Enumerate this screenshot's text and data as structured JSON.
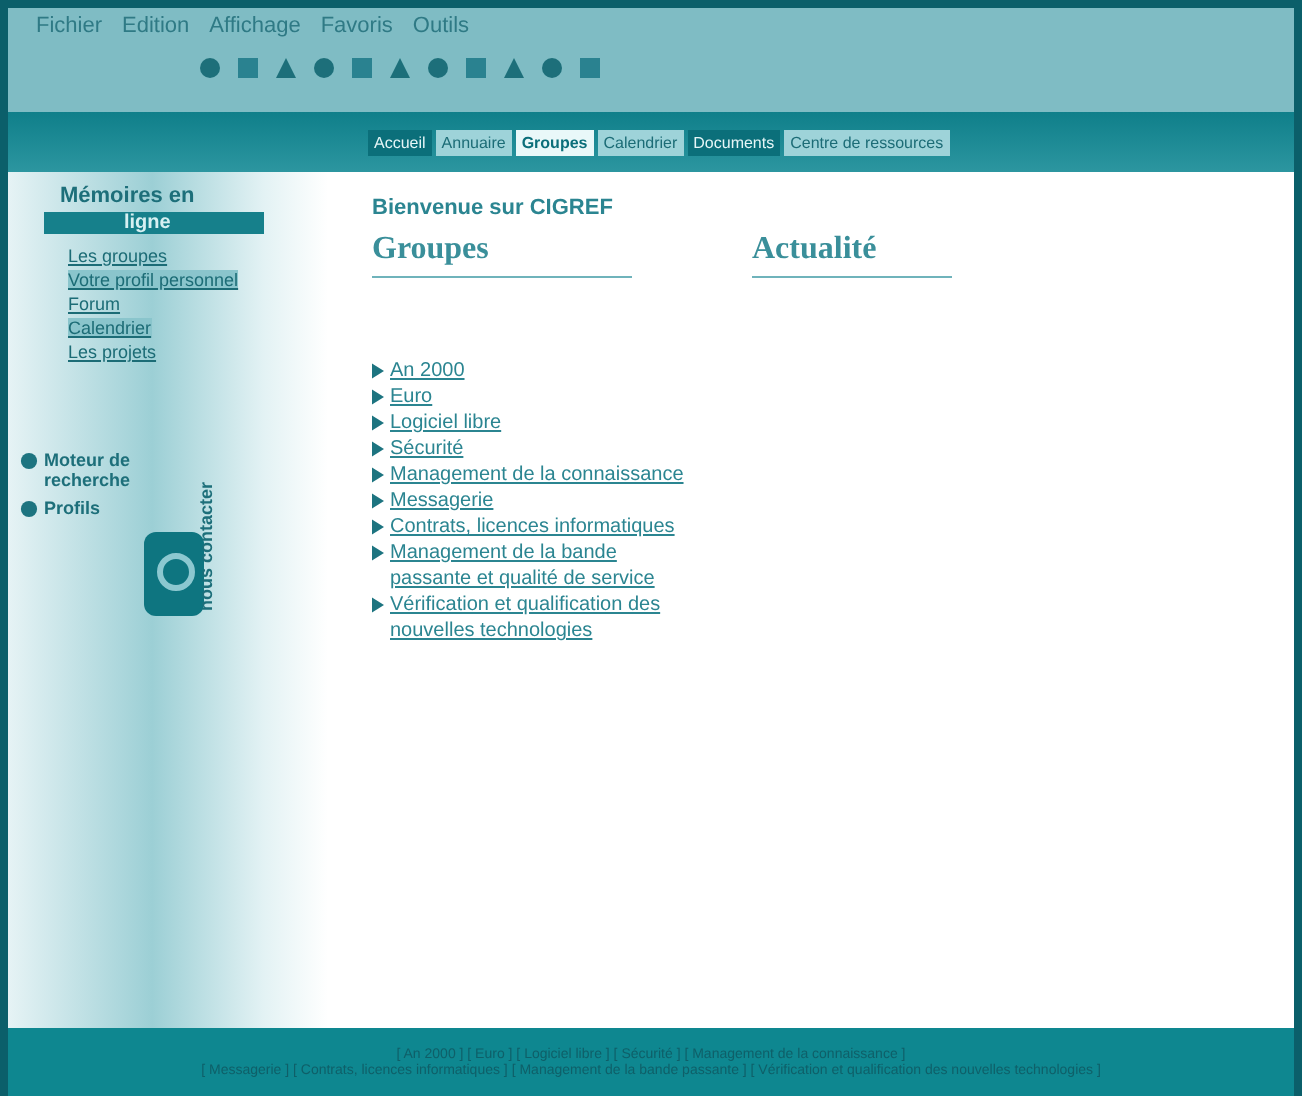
{
  "menu": [
    "Fichier",
    "Edition",
    "Affichage",
    "Favoris",
    "Outils"
  ],
  "toolbar_buttons": [
    {
      "kind": "round"
    },
    {
      "kind": "square"
    },
    {
      "kind": "triangle"
    },
    {
      "kind": "round"
    },
    {
      "kind": "square"
    },
    {
      "kind": "triangle"
    },
    {
      "kind": "round"
    },
    {
      "kind": "square"
    },
    {
      "kind": "triangle"
    },
    {
      "kind": "round"
    },
    {
      "kind": "square"
    }
  ],
  "nav_tabs": [
    {
      "label": "Accueil",
      "selected": false
    },
    {
      "label": "Annuaire",
      "selected": false
    },
    {
      "label": "Groupes",
      "selected": true
    },
    {
      "label": "Calendrier",
      "selected": false
    },
    {
      "label": "Documents",
      "selected": false
    },
    {
      "label": "Centre de ressources",
      "selected": false
    }
  ],
  "sidebar": {
    "title": "Mémoires en",
    "subtitle": "ligne",
    "links": [
      {
        "label": "Les groupes",
        "selected": false
      },
      {
        "label": "Votre profil personnel",
        "selected": true
      },
      {
        "label": "Forum",
        "selected": false
      },
      {
        "label": "Calendrier",
        "selected": true
      },
      {
        "label": "Les projets",
        "selected": false
      }
    ],
    "tools": [
      {
        "label": "Moteur de recherche"
      },
      {
        "label": "Profils"
      }
    ],
    "contact": "nous contacter"
  },
  "welcome": "Bienvenue sur CIGREF",
  "columns": [
    {
      "heading": "Groupes"
    },
    {
      "heading": "Actualité"
    }
  ],
  "groups": [
    "An 2000",
    "Euro",
    "Logiciel libre",
    "Sécurité",
    "Management de la connaissance",
    "Messagerie",
    "Contrats, licences informatiques",
    "Management de la bande passante et qualité de service",
    "Vérification et qualification des nouvelles technologies"
  ],
  "footer": [
    "[ An 2000 ] [ Euro ] [ Logiciel libre ] [ Sécurité ] [ Management de la connaissance ]",
    "[ Messagerie ] [ Contrats, licences informatiques ] [ Management de la bande passante ] [ Vérification et qualification des nouvelles technologies ]"
  ]
}
